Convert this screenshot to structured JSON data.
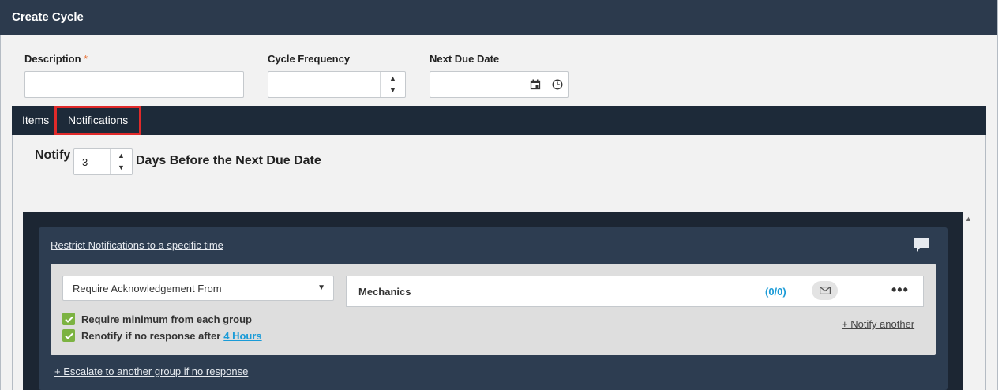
{
  "dialog": {
    "title": "Create Cycle"
  },
  "form": {
    "description": {
      "label": "Description",
      "required_mark": "*",
      "value": ""
    },
    "cycle_frequency": {
      "label": "Cycle Frequency",
      "value": ""
    },
    "next_due_date": {
      "label": "Next Due Date",
      "value": ""
    }
  },
  "tabs": [
    {
      "label": "Items",
      "active": false
    },
    {
      "label": "Notifications",
      "active": true
    }
  ],
  "notify": {
    "prefix": "Notify",
    "days_value": "3",
    "suffix": "Days Before the Next Due Date"
  },
  "rule": {
    "restrict_link": "Restrict Notifications to a specific time",
    "ack_select": "Require Acknowledgement From",
    "group": {
      "name": "Mechanics",
      "count": "(0/0)"
    },
    "checks": [
      {
        "label": "Require minimum from each group",
        "checked": true
      },
      {
        "label": "Renotify if no response after",
        "link": "4 Hours",
        "checked": true
      }
    ],
    "notify_another": "+ Notify another",
    "escalate": "+ Escalate to another group if no response"
  },
  "colors": {
    "header": "#2c3a4d",
    "tabbar": "#1d2a39",
    "active_tab_highlight": "#e12a2a",
    "count": "#1a9bd7",
    "check": "#7cb342"
  }
}
